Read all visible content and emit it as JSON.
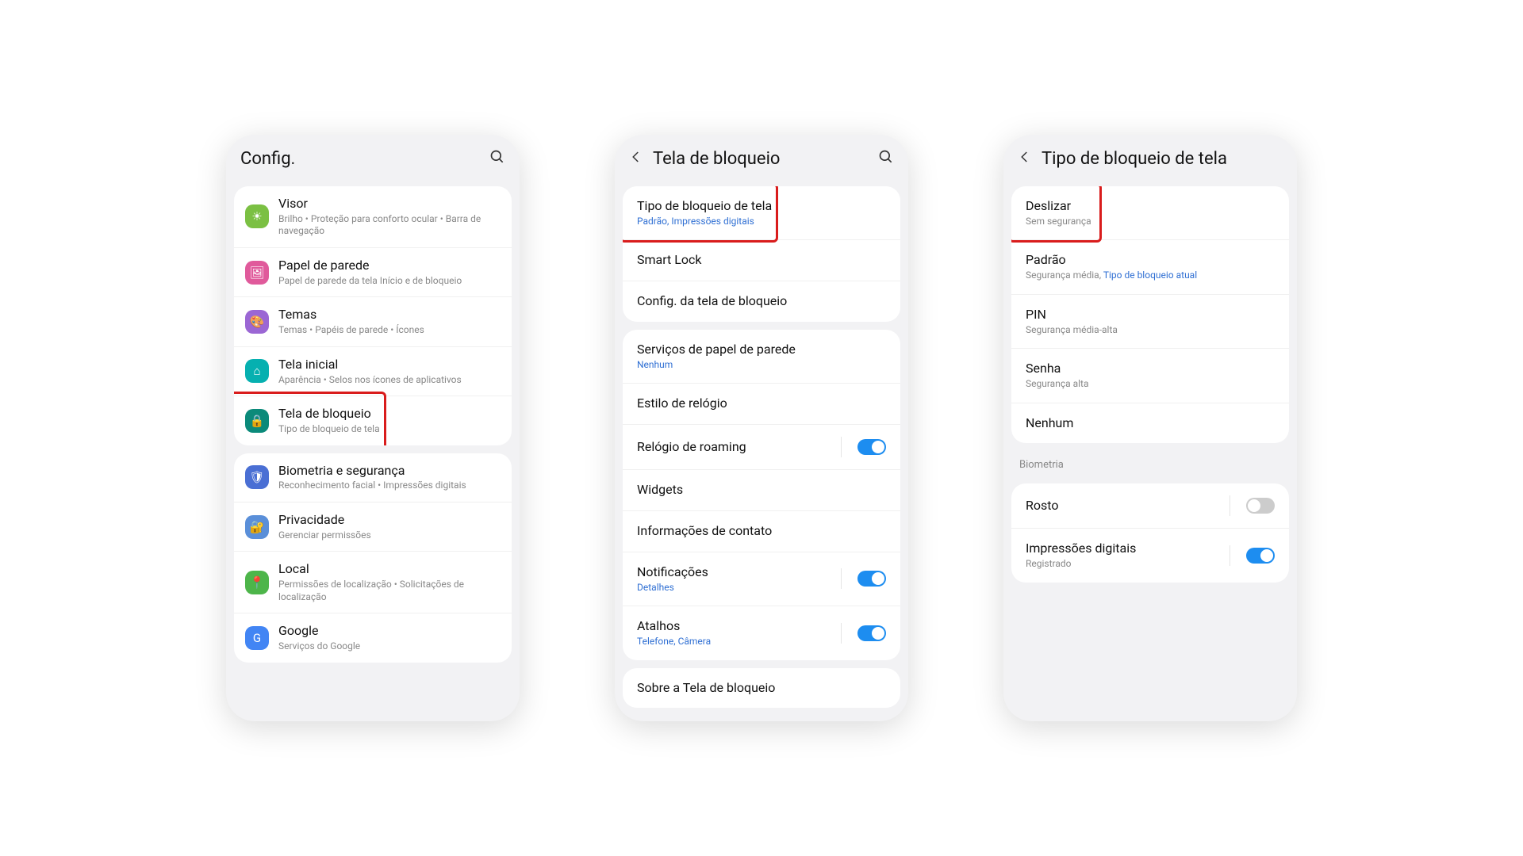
{
  "phone1": {
    "header": {
      "title": "Config."
    },
    "groups": [
      {
        "items": [
          {
            "key": "visor",
            "icon": "ic-green",
            "glyph": "☀",
            "title": "Visor",
            "sub": "Brilho  •  Proteção para conforto ocular  •  Barra de navegação"
          },
          {
            "key": "wallpaper",
            "icon": "ic-pink",
            "glyph": "🖼",
            "title": "Papel de parede",
            "sub": "Papel de parede da tela Início e de bloqueio"
          },
          {
            "key": "themes",
            "icon": "ic-purple",
            "glyph": "🎨",
            "title": "Temas",
            "sub": "Temas  •  Papéis de parede  •  Ícones"
          },
          {
            "key": "home",
            "icon": "ic-teal",
            "glyph": "⌂",
            "title": "Tela inicial",
            "sub": "Aparência  •  Selos nos ícones de aplicativos"
          },
          {
            "key": "lockscreen",
            "icon": "ic-tealdark",
            "glyph": "🔒",
            "title": "Tela de bloqueio",
            "sub": "Tipo de bloqueio de tela",
            "highlight": true
          }
        ]
      },
      {
        "items": [
          {
            "key": "biometrics",
            "icon": "ic-blue",
            "glyph": "🛡",
            "title": "Biometria e segurança",
            "sub": "Reconhecimento facial  •  Impressões digitais"
          },
          {
            "key": "privacy",
            "icon": "ic-lblue",
            "glyph": "🔐",
            "title": "Privacidade",
            "sub": "Gerenciar permissões"
          },
          {
            "key": "location",
            "icon": "ic-limegreen",
            "glyph": "📍",
            "title": "Local",
            "sub": "Permissões de localização  •  Solicitações de localização"
          },
          {
            "key": "google",
            "icon": "ic-gblue",
            "glyph": "G",
            "title": "Google",
            "sub": "Serviços do Google"
          }
        ]
      }
    ]
  },
  "phone2": {
    "header": {
      "title": "Tela de bloqueio",
      "back": true,
      "search": true
    },
    "groups": [
      {
        "items": [
          {
            "key": "locktype",
            "title": "Tipo de bloqueio de tela",
            "subBlue": "Padrão, Impressões digitais",
            "highlight": true
          },
          {
            "key": "smartlock",
            "title": "Smart Lock"
          },
          {
            "key": "locksettings",
            "title": "Config. da tela de bloqueio"
          }
        ]
      },
      {
        "items": [
          {
            "key": "wpservices",
            "title": "Serviços de papel de parede",
            "subBlue": "Nenhum"
          },
          {
            "key": "clockstyle",
            "title": "Estilo de relógio"
          },
          {
            "key": "roamingclock",
            "title": "Relógio de roaming",
            "toggle": "on"
          },
          {
            "key": "widgets",
            "title": "Widgets"
          },
          {
            "key": "contactinfo",
            "title": "Informações de contato"
          },
          {
            "key": "notifications",
            "title": "Notificações",
            "subBlue": "Detalhes",
            "toggle": "on"
          },
          {
            "key": "shortcuts",
            "title": "Atalhos",
            "subBlue": "Telefone, Câmera",
            "toggle": "on"
          }
        ]
      },
      {
        "items": [
          {
            "key": "about",
            "title": "Sobre a Tela de bloqueio"
          }
        ]
      }
    ]
  },
  "phone3": {
    "header": {
      "title": "Tipo de bloqueio de tela",
      "back": true
    },
    "groups": [
      {
        "items": [
          {
            "key": "swipe",
            "title": "Deslizar",
            "sub": "Sem segurança",
            "highlight": true
          },
          {
            "key": "pattern",
            "title": "Padrão",
            "subMixed": {
              "gray": "Segurança média, ",
              "blue": "Tipo de bloqueio atual"
            }
          },
          {
            "key": "pin",
            "title": "PIN",
            "sub": "Segurança média-alta"
          },
          {
            "key": "password",
            "title": "Senha",
            "sub": "Segurança alta"
          },
          {
            "key": "none",
            "title": "Nenhum"
          }
        ]
      },
      {
        "label": "Biometria",
        "items": [
          {
            "key": "face",
            "title": "Rosto",
            "toggle": "off"
          },
          {
            "key": "fingerprint",
            "title": "Impressões digitais",
            "sub": "Registrado",
            "toggle": "on"
          }
        ]
      }
    ]
  }
}
